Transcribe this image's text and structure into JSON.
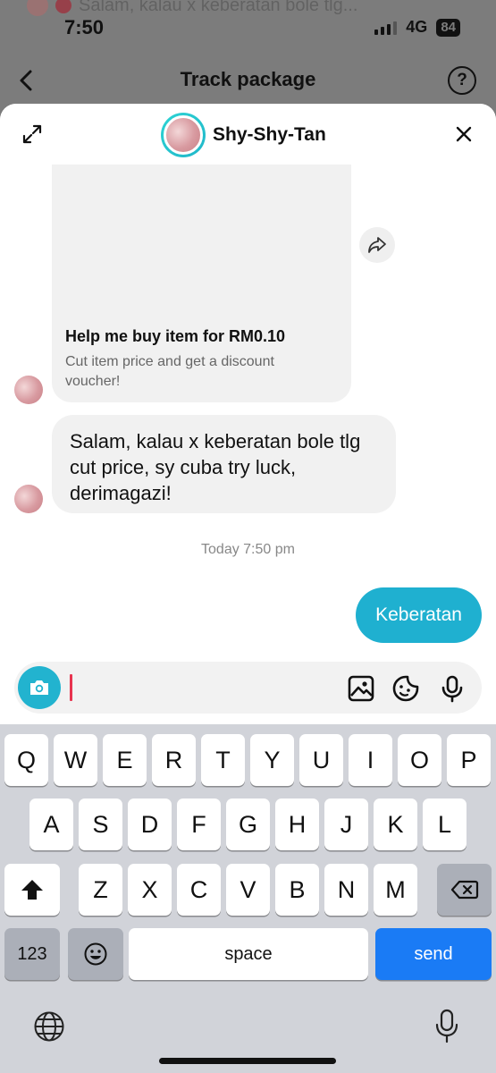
{
  "status_bar": {
    "time": "7:50",
    "network": "4G",
    "battery": "84",
    "notification_preview": "Salam, kalau x keberatan bole tlg..."
  },
  "nav": {
    "title": "Track package",
    "back_icon": "chevron-left-icon",
    "help_icon": "question-circle-icon",
    "help_glyph": "?"
  },
  "chat": {
    "shop_name": "Shy-Shy-Tan",
    "expand_icon": "expand-arrows-icon",
    "close_icon": "close-icon",
    "card": {
      "title": "Help me buy item for RM0.10",
      "description": "Cut item price and get a discount voucher!",
      "share_icon": "share-arrow-icon"
    },
    "incoming_message": "Salam, kalau x keberatan bole tlg cut price, sy cuba try luck, derimagazi!",
    "timestamp": "Today 7:50 pm",
    "outgoing_message": "Keberatan"
  },
  "composer": {
    "value": "",
    "camera_icon": "camera-icon",
    "image_icon": "image-icon",
    "sticker_icon": "sticker-icon",
    "mic_icon": "microphone-icon"
  },
  "keyboard": {
    "row1": [
      "Q",
      "W",
      "E",
      "R",
      "T",
      "Y",
      "U",
      "I",
      "O",
      "P"
    ],
    "row2": [
      "A",
      "S",
      "D",
      "F",
      "G",
      "H",
      "J",
      "K",
      "L"
    ],
    "row3": [
      "Z",
      "X",
      "C",
      "V",
      "B",
      "N",
      "M"
    ],
    "numbers_label": "123",
    "space_label": "space",
    "send_label": "send",
    "shift_icon": "shift-icon",
    "backspace_icon": "backspace-icon",
    "emoji_icon": "emoji-icon",
    "globe_icon": "globe-icon",
    "dictation_icon": "microphone-icon"
  },
  "colors": {
    "accent": "#1fb0d0",
    "send_key": "#1a7bf5",
    "caret": "#e8344f"
  }
}
